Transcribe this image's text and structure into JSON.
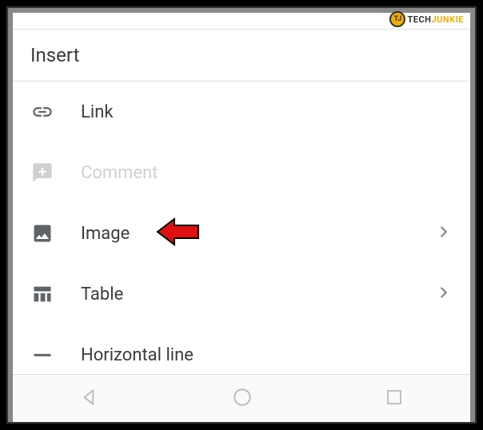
{
  "watermark": {
    "badge": "TJ",
    "text_part1": "TECH",
    "text_part2": "JUNKIE"
  },
  "header": {
    "title": "Insert"
  },
  "menu": {
    "items": [
      {
        "label": "Link",
        "icon": "link-icon",
        "disabled": false,
        "chevron": false
      },
      {
        "label": "Comment",
        "icon": "comment-icon",
        "disabled": true,
        "chevron": false
      },
      {
        "label": "Image",
        "icon": "image-icon",
        "disabled": false,
        "chevron": true,
        "highlight_arrow": true
      },
      {
        "label": "Table",
        "icon": "table-icon",
        "disabled": false,
        "chevron": true
      },
      {
        "label": "Horizontal line",
        "icon": "horizontal-line-icon",
        "disabled": false,
        "chevron": false
      }
    ]
  },
  "navbar": {
    "back": "back",
    "home": "home",
    "recent": "recent"
  }
}
